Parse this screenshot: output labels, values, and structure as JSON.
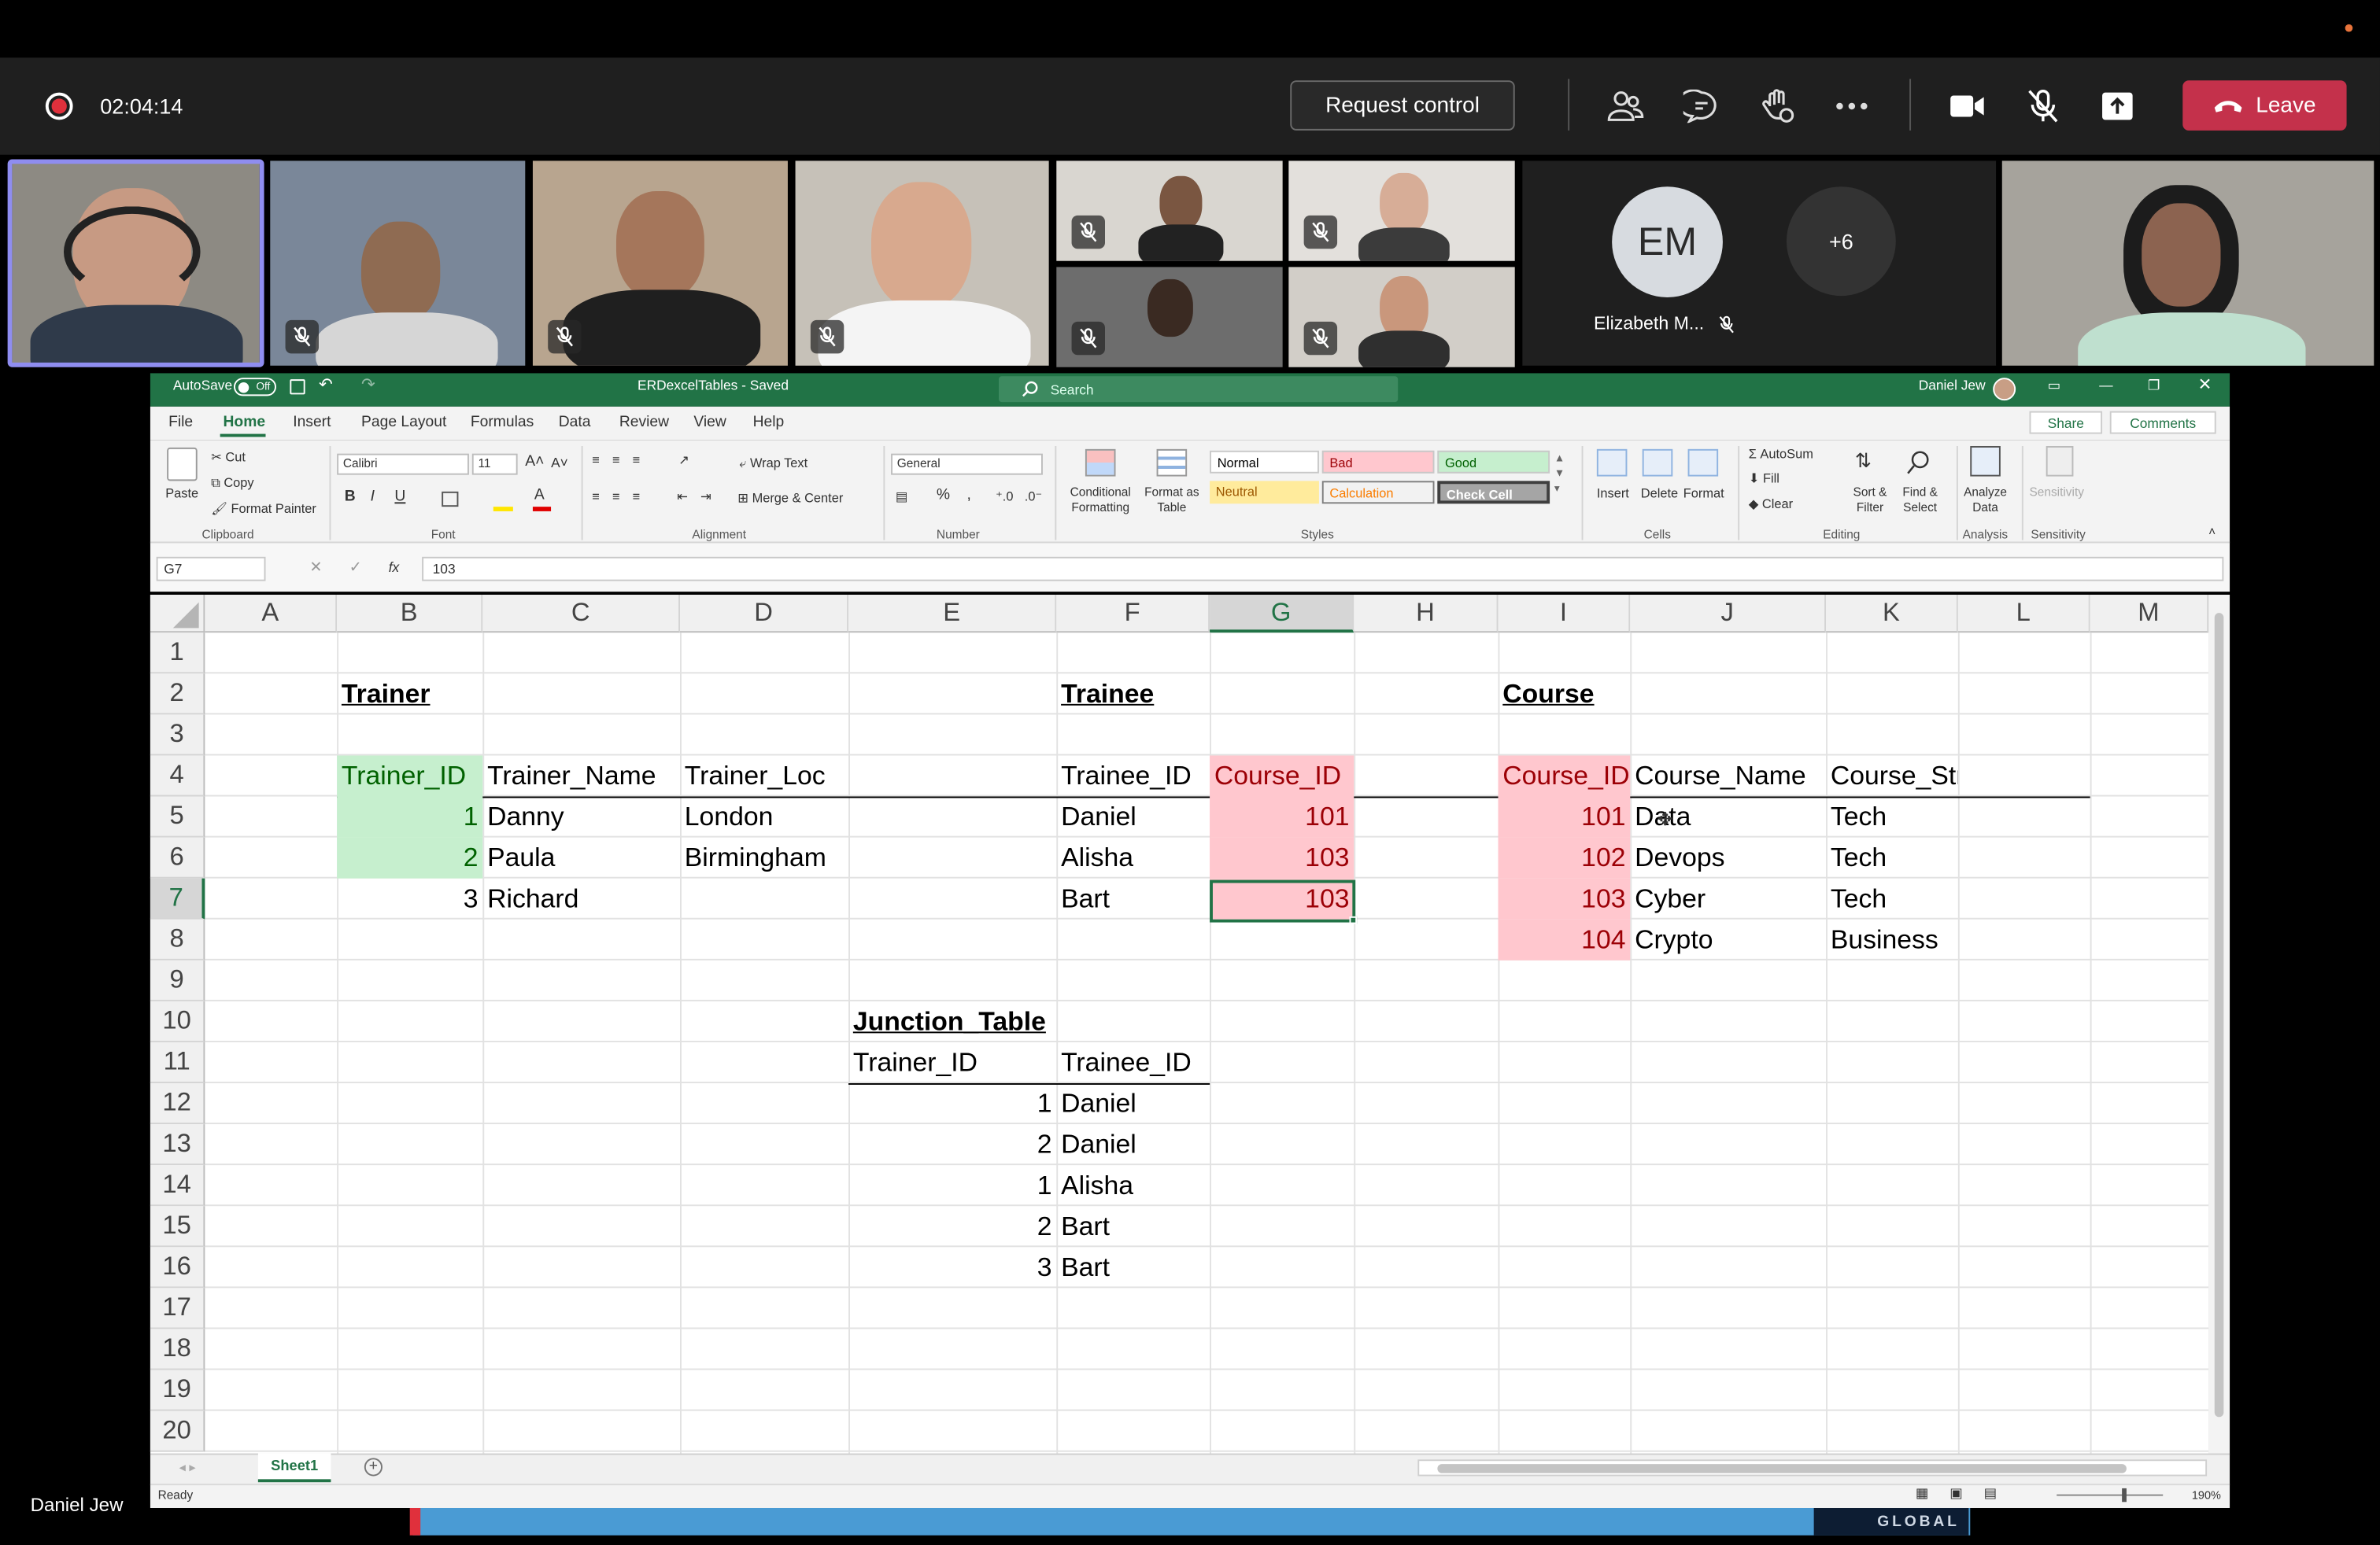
{
  "call": {
    "timer": "02:04:14",
    "request_control": "Request control",
    "leave": "Leave",
    "avatar_initials": "EM",
    "avatar_name": "Elizabeth M...",
    "overflow_count": "+6",
    "presenter_name": "Daniel Jew"
  },
  "excel": {
    "autosave": "AutoSave",
    "autosave_state": "Off",
    "file_title": "ERDexcelTables - Saved",
    "search_placeholder": "Search",
    "user_name": "Daniel Jew",
    "tabs": [
      "File",
      "Home",
      "Insert",
      "Page Layout",
      "Formulas",
      "Data",
      "Review",
      "View",
      "Help"
    ],
    "share": "Share",
    "comments": "Comments",
    "ribbon": {
      "paste": "Paste",
      "cut": "Cut",
      "copy": "Copy",
      "format_painter": "Format Painter",
      "font_name": "Calibri",
      "font_size": "11",
      "wrap_text": "Wrap Text",
      "merge_center": "Merge & Center",
      "number_format": "General",
      "conditional_formatting": "Conditional Formatting",
      "format_as_table": "Format as Table",
      "style_normal": "Normal",
      "style_bad": "Bad",
      "style_good": "Good",
      "style_neutral": "Neutral",
      "style_calculation": "Calculation",
      "style_check": "Check Cell",
      "insert": "Insert",
      "delete": "Delete",
      "format": "Format",
      "autosum": "AutoSum",
      "fill": "Fill",
      "clear": "Clear",
      "sort_filter": "Sort & Filter",
      "find_select": "Find & Select",
      "analyze_data": "Analyze Data",
      "sensitivity": "Sensitivity",
      "groups": [
        "Clipboard",
        "Font",
        "Alignment",
        "Number",
        "Styles",
        "Cells",
        "Editing",
        "Analysis",
        "Sensitivity"
      ]
    },
    "name_box": "G7",
    "formula": "103",
    "columns": [
      "A",
      "B",
      "C",
      "D",
      "E",
      "F",
      "G",
      "H",
      "I",
      "J",
      "K",
      "L",
      "M"
    ],
    "rows": [
      "1",
      "2",
      "3",
      "4",
      "5",
      "6",
      "7",
      "8",
      "9",
      "10",
      "11",
      "12",
      "13",
      "14",
      "15",
      "16",
      "17",
      "18",
      "19",
      "20"
    ],
    "cells": {
      "trainer_title": "Trainer",
      "trainee_title": "Trainee",
      "course_title": "Course",
      "junction_title": "Junction_Table",
      "trainer_headers": [
        "Trainer_ID",
        "Trainer_Name",
        "Trainer_Loc"
      ],
      "trainers": [
        {
          "id": "1",
          "name": "Danny",
          "loc": "London"
        },
        {
          "id": "2",
          "name": "Paula",
          "loc": "Birmingham"
        },
        {
          "id": "3",
          "name": "Richard",
          "loc": ""
        }
      ],
      "trainee_headers": [
        "Trainee_ID",
        "Course_ID"
      ],
      "trainees": [
        {
          "id": "Daniel",
          "course": "101"
        },
        {
          "id": "Alisha",
          "course": "103"
        },
        {
          "id": "Bart",
          "course": "103"
        }
      ],
      "course_headers": [
        "Course_ID",
        "Course_Name",
        "Course_Stream"
      ],
      "courses": [
        {
          "id": "101",
          "name": "Data",
          "stream": "Tech"
        },
        {
          "id": "102",
          "name": "Devops",
          "stream": "Tech"
        },
        {
          "id": "103",
          "name": "Cyber",
          "stream": "Tech"
        },
        {
          "id": "104",
          "name": "Crypto",
          "stream": "Business"
        }
      ],
      "junction_headers": [
        "Trainer_ID",
        "Trainee_ID"
      ],
      "junction": [
        {
          "trainer": "1",
          "trainee": "Daniel"
        },
        {
          "trainer": "2",
          "trainee": "Daniel"
        },
        {
          "trainer": "1",
          "trainee": "Alisha"
        },
        {
          "trainer": "2",
          "trainee": "Bart"
        },
        {
          "trainer": "3",
          "trainee": "Bart"
        }
      ]
    },
    "sheet_tab": "Sheet1",
    "status": "Ready",
    "zoom": "190%",
    "watermark": "GLOBAL"
  },
  "colors": {
    "excel_green": "#217346",
    "leave_red": "#c4314b",
    "good_fill": "#c6efce",
    "bad_fill": "#ffc7ce"
  }
}
